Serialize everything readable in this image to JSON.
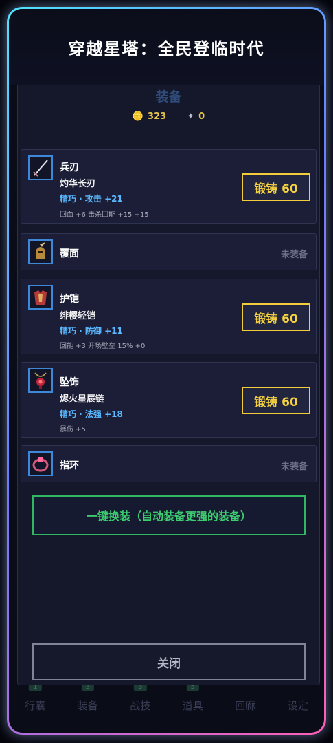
{
  "app_title": "穿越星塔：全民登临时代",
  "modal": {
    "title": "装备",
    "gold": "323",
    "shards": "0",
    "items": [
      {
        "slot": "兵刃",
        "name": "灼华长刃",
        "stat": "精巧 · 攻击 +21",
        "extra": "回血 +6  击杀回能 +15 +15",
        "forge": "锻铸 60",
        "icon": "sword-icon"
      },
      {
        "slot": "覆面",
        "status": "未装备",
        "icon": "helmet-icon"
      },
      {
        "slot": "护铠",
        "name": "绯樱轻铠",
        "stat": "精巧 · 防御 +11",
        "extra": "回能 +3  开场壁垒 15% +0",
        "forge": "锻铸 60",
        "icon": "armor-icon"
      },
      {
        "slot": "坠饰",
        "name": "烬火星辰链",
        "stat": "精巧 · 法强 +18",
        "extra": "暴伤 +5",
        "forge": "锻铸 60",
        "icon": "necklace-icon"
      },
      {
        "slot": "指环",
        "status": "未装备",
        "icon": "ring-icon"
      }
    ],
    "auto_equip_label": "一键换装（自动装备更强的装备）",
    "close_label": "关闭"
  },
  "bottom_nav": [
    {
      "label": "行囊",
      "badge": "1"
    },
    {
      "label": "装备",
      "badge": "3"
    },
    {
      "label": "战技",
      "badge": "3"
    },
    {
      "label": "道具",
      "badge": "5"
    },
    {
      "label": "回廊",
      "badge": ""
    },
    {
      "label": "设定",
      "badge": ""
    }
  ],
  "colors": {
    "accent_gold": "#f2cc3a",
    "accent_green": "#2fb761",
    "stat_blue": "#59b8ff"
  }
}
